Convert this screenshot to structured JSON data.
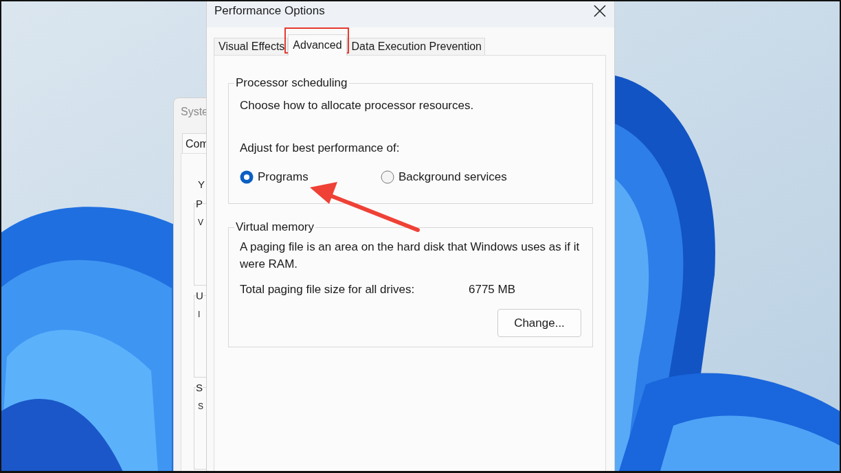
{
  "background_window": {
    "title": "Syste",
    "tab": "Com",
    "intro": "Y",
    "groups": [
      {
        "title": "P",
        "line": "V"
      },
      {
        "title": "U",
        "line": "I"
      },
      {
        "title": "S",
        "line": "S"
      }
    ]
  },
  "dialog": {
    "title": "Performance Options",
    "tabs": [
      {
        "label": "Visual Effects",
        "selected": false
      },
      {
        "label": "Advanced",
        "selected": true
      },
      {
        "label": "Data Execution Prevention",
        "selected": false
      }
    ],
    "processor_scheduling": {
      "title": "Processor scheduling",
      "description": "Choose how to allocate processor resources.",
      "prompt": "Adjust for best performance of:",
      "options": [
        {
          "label": "Programs",
          "selected": true
        },
        {
          "label": "Background services",
          "selected": false
        }
      ]
    },
    "virtual_memory": {
      "title": "Virtual memory",
      "description": "A paging file is an area on the hard disk that Windows uses as if it were RAM.",
      "total_label": "Total paging file size for all drives:",
      "total_value": "6775 MB",
      "button": "Change..."
    }
  }
}
